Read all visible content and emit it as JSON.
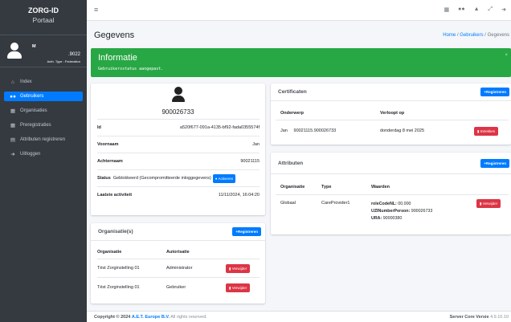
{
  "sidebar": {
    "brand_title": "ZORG-ID",
    "brand_subtitle": "Portaal",
    "user_name": "M",
    "user_id": ".9022",
    "auth_type": "Auth. Type : Federation",
    "items": [
      {
        "label": "Index",
        "icon": "home-icon"
      },
      {
        "label": "Gebruikers",
        "icon": "users-icon",
        "active": true
      },
      {
        "label": "Organisaties",
        "icon": "building-icon"
      },
      {
        "label": "Preregistraties",
        "icon": "building-icon"
      },
      {
        "label": "Attributen registreren",
        "icon": "list-icon"
      },
      {
        "label": "Uitloggen",
        "icon": "logout-icon"
      }
    ]
  },
  "header": {
    "title": "Gegevens",
    "breadcrumb": {
      "home": "Home",
      "sep": "/",
      "users": "Gebruikers",
      "current": "Gegevens"
    }
  },
  "banner": {
    "title": "Informatie",
    "message": "Gebruikersstatus aangepast.",
    "close": "×"
  },
  "profile": {
    "name": "900026733",
    "id_label": "Id",
    "id_value": "a520f677-091a-4135-bf92-fada0355574f",
    "first_label": "Voornaam",
    "first_value": "Jan",
    "last_label": "Achternaam",
    "last_value": "90021115",
    "status_label": "Status",
    "status_value": "Geblokkeerd (Gecompromitteerde inloggegevens)",
    "activate_label": "Activeren",
    "activity_label": "Laatste activiteit",
    "activity_value": "11/11/2024, 16:04:20"
  },
  "organisations": {
    "title": "Organisatie(s)",
    "register_label": "Registreren",
    "columns": [
      "Organisatie",
      "Autorisatie"
    ],
    "rows": [
      {
        "org": "Tëst Zorginstelling 01",
        "auth": "Administrator",
        "action": "Verwijder"
      },
      {
        "org": "Tëst Zorginstelling 01",
        "auth": "Gebruiker",
        "action": "Verwijder"
      }
    ]
  },
  "certificates": {
    "title": "Certificaten",
    "register_label": "Registreren",
    "columns": [
      "Onderwerp",
      "Verloopt op"
    ],
    "rows": [
      {
        "subject": "Jan     90021115.900026733",
        "expires": "donderdag 8 mei 2025",
        "action": "Intrekken"
      }
    ]
  },
  "attributes": {
    "title": "Attributen",
    "register_label": "Registreren",
    "columns": [
      "Organisatie",
      "Type",
      "Waarden"
    ],
    "rows": [
      {
        "org": "Globaal",
        "type": "CareProvider1",
        "values": [
          {
            "key": "roleCodeNL:",
            "val": "00.000"
          },
          {
            "key": "UZINumberPerson:",
            "val": "900026733"
          },
          {
            "key": "URA:",
            "val": "90000380"
          }
        ],
        "action": "Verwijder"
      }
    ]
  },
  "footer": {
    "copyright_prefix": "Copyright © 2024",
    "company": "A.E.T. Europe B.V.",
    "rights": "All rights reserved.",
    "version_label": "Server Core Versie",
    "version": "4.9.10.10"
  },
  "colors": {
    "primary": "#007bff",
    "success": "#28a745",
    "danger": "#dc3545",
    "sidebar": "#343a40"
  }
}
